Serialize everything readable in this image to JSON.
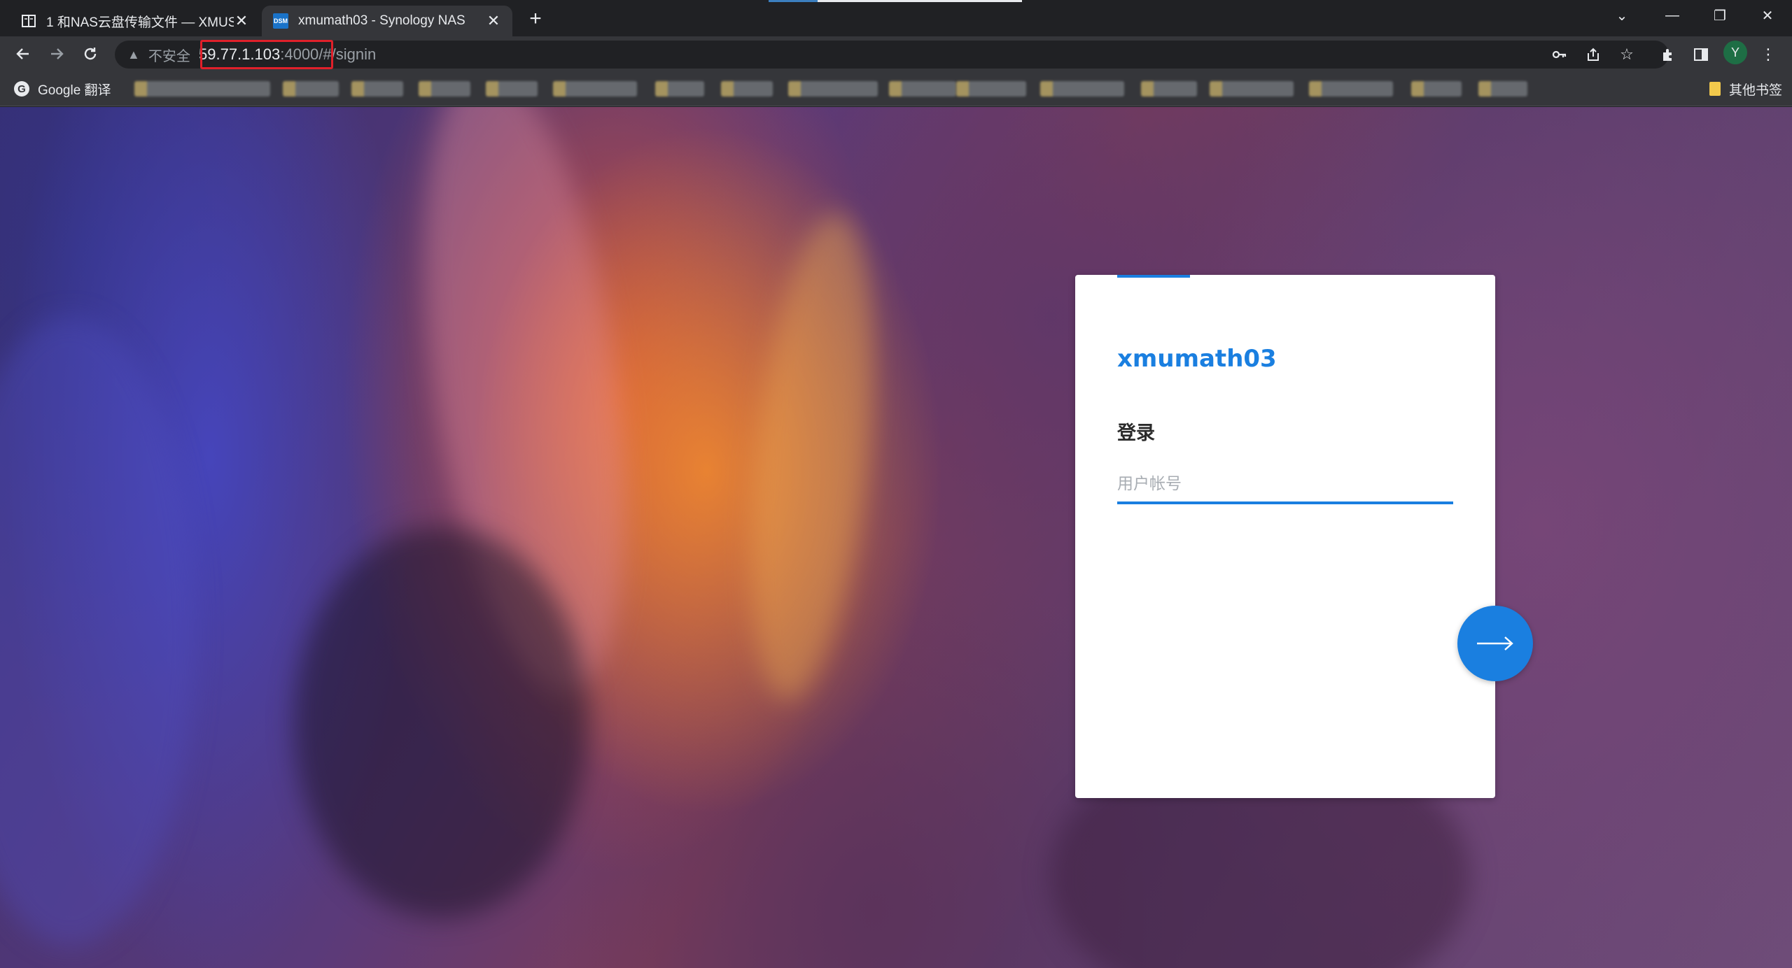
{
  "tabs": [
    {
      "title": "1 和NAS云盘传输文件 — XMUS",
      "icon": "book-icon",
      "active": false
    },
    {
      "title": "xmumath03 - Synology NAS",
      "icon": "dsm-icon",
      "favicon_text": "DSM",
      "active": true
    }
  ],
  "address_bar": {
    "security_label": "不安全",
    "host": "59.77.1.103",
    "port": ":4000",
    "path": "/#/signin"
  },
  "bookmarks": {
    "google_translate": "Google 翻译",
    "other_bookmarks": "其他书签"
  },
  "profile_initial": "Y",
  "login": {
    "server_name": "xmumath03",
    "heading": "登录",
    "username_placeholder": "用户帐号",
    "username_value": ""
  },
  "colors": {
    "accent": "#1a7fe0",
    "highlight_box": "#e0202a"
  }
}
